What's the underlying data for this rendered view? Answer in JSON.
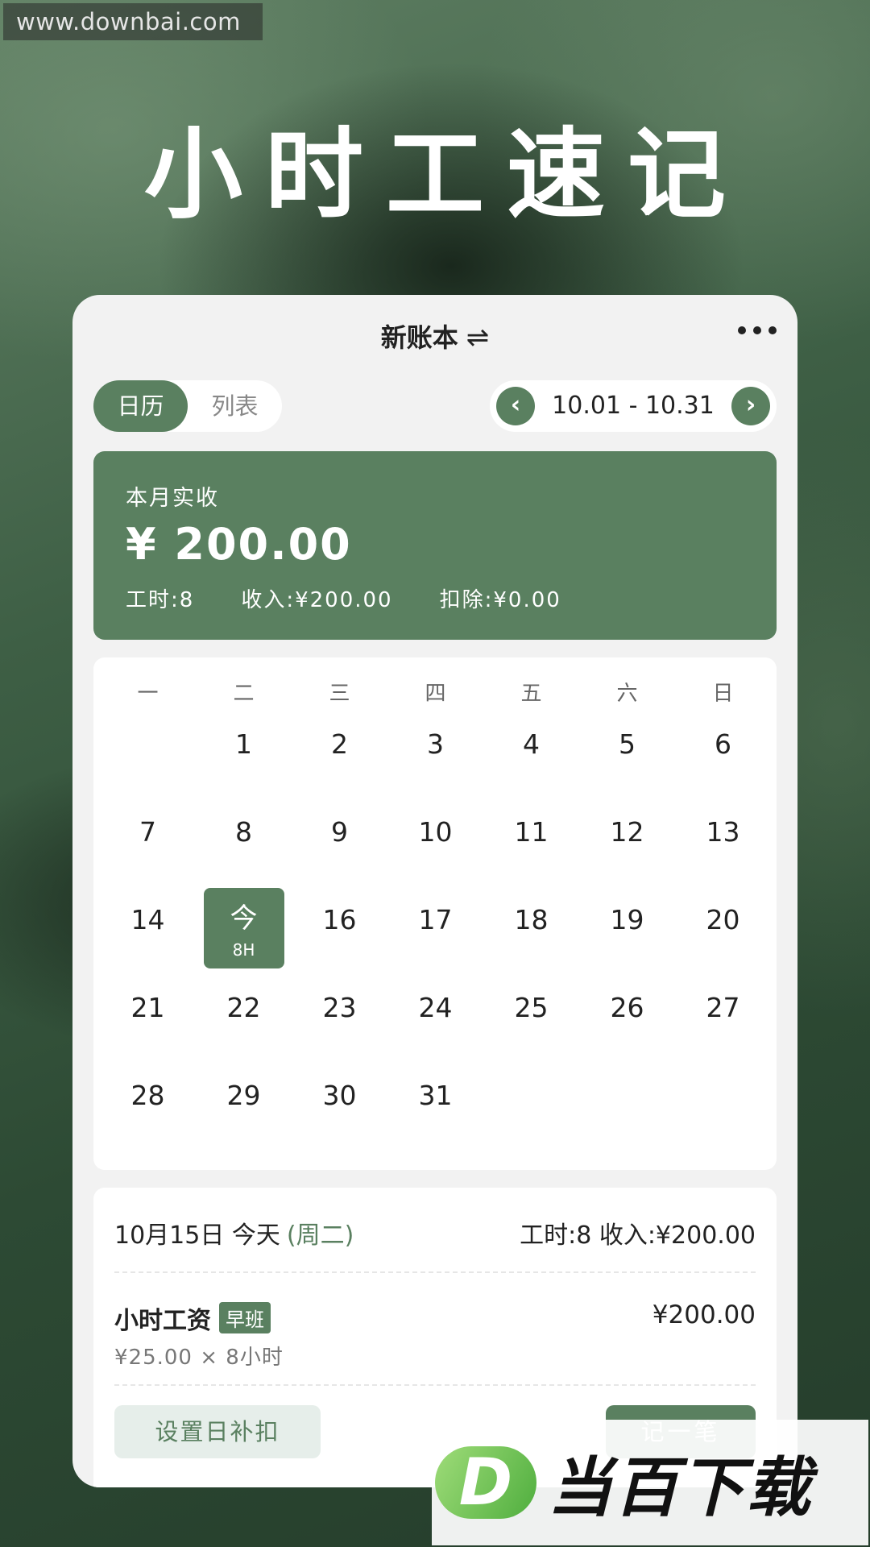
{
  "watermark_top": "www.downbai.com",
  "hero_title": "小时工速记",
  "header": {
    "title": "新账本",
    "swap_icon": "⇌"
  },
  "view_toggle": {
    "calendar": "日历",
    "list": "列表",
    "active": "calendar"
  },
  "range": {
    "text": "10.01 - 10.31",
    "prev_icon": "‹",
    "next_icon": "›"
  },
  "summary": {
    "label": "本月实收",
    "amount": "¥ 200.00",
    "hours": "工时:8",
    "income": "收入:¥200.00",
    "deduction": "扣除:¥0.00"
  },
  "calendar": {
    "weekdays": [
      "一",
      "二",
      "三",
      "四",
      "五",
      "六",
      "日"
    ],
    "leading_blanks": 1,
    "days": [
      "1",
      "2",
      "3",
      "4",
      "5",
      "6",
      "7",
      "8",
      "9",
      "10",
      "11",
      "12",
      "13",
      "14",
      "15",
      "16",
      "17",
      "18",
      "19",
      "20",
      "21",
      "22",
      "23",
      "24",
      "25",
      "26",
      "27",
      "28",
      "29",
      "30",
      "31"
    ],
    "today": "15",
    "today_label": "今",
    "today_hours": "8H"
  },
  "detail": {
    "date": "10月15日 今天",
    "weekday": "(周二)",
    "day_stats": "工时:8  收入:¥200.00",
    "entry_name": "小时工资",
    "shift": "早班",
    "entry_amount": "¥200.00",
    "formula": "¥25.00 × 8小时",
    "adjust_button": "设置日补扣",
    "record_button": "记一笔"
  },
  "brand_watermark": {
    "logo": "D",
    "text": "当百下载"
  },
  "colors": {
    "accent": "#5a8060",
    "card_bg": "#f2f2f2"
  }
}
